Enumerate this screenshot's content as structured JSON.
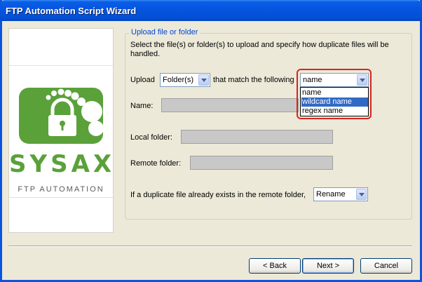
{
  "window": {
    "title": "FTP Automation Script Wizard"
  },
  "logo": {
    "brand": "SYSAX",
    "subtitle": "FTP AUTOMATION"
  },
  "group": {
    "title": "Upload file or folder",
    "description": "Select the file(s) or folder(s) to upload and specify how duplicate files will be handled."
  },
  "upload": {
    "label": "Upload",
    "type_value": "Folder(s)",
    "match_label": "that match the following",
    "match_value": "name",
    "match_options": [
      "name",
      "wildcard name",
      "regex name"
    ],
    "match_selected_index": 1
  },
  "fields": {
    "name_label": "Name:",
    "local_label": "Local folder:",
    "remote_label": "Remote folder:"
  },
  "duplicate": {
    "label": "If a duplicate file already exists in the remote folder,",
    "value": "Rename"
  },
  "buttons": {
    "back": "< Back",
    "next": "Next >",
    "cancel": "Cancel"
  },
  "colors": {
    "titlebar": "#0655e0",
    "brand_green": "#5aa13a",
    "group_title": "#0046d5",
    "selection": "#316ac5",
    "highlight": "#d82424"
  }
}
